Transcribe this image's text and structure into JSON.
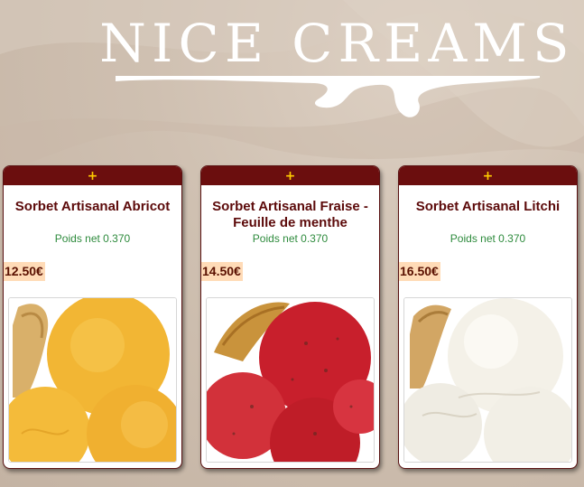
{
  "brand": {
    "name": "Nice Creams"
  },
  "products": [
    {
      "add_icon": "plus-icon",
      "add_symbol": "+",
      "name": "Sorbet Artisanal Abricot",
      "weight": "Poids net 0.370",
      "price": "12.50€",
      "flavor_color": "#f0b030"
    },
    {
      "add_icon": "plus-icon",
      "add_symbol": "+",
      "name": "Sorbet Artisanal Fraise - Feuille de menthe",
      "weight": "Poids net 0.370",
      "price": "14.50€",
      "flavor_color": "#d2313a"
    },
    {
      "add_icon": "plus-icon",
      "add_symbol": "+",
      "name": "Sorbet Artisanal Litchi",
      "weight": "Poids net 0.370",
      "price": "16.50€",
      "flavor_color": "#f4f1e8"
    }
  ],
  "colors": {
    "card_bar": "#6b0e0e",
    "title": "#5c0a0a",
    "weight": "#2e8b3d",
    "price_bg": "#ffdbb7",
    "plus": "#ffcc00"
  }
}
